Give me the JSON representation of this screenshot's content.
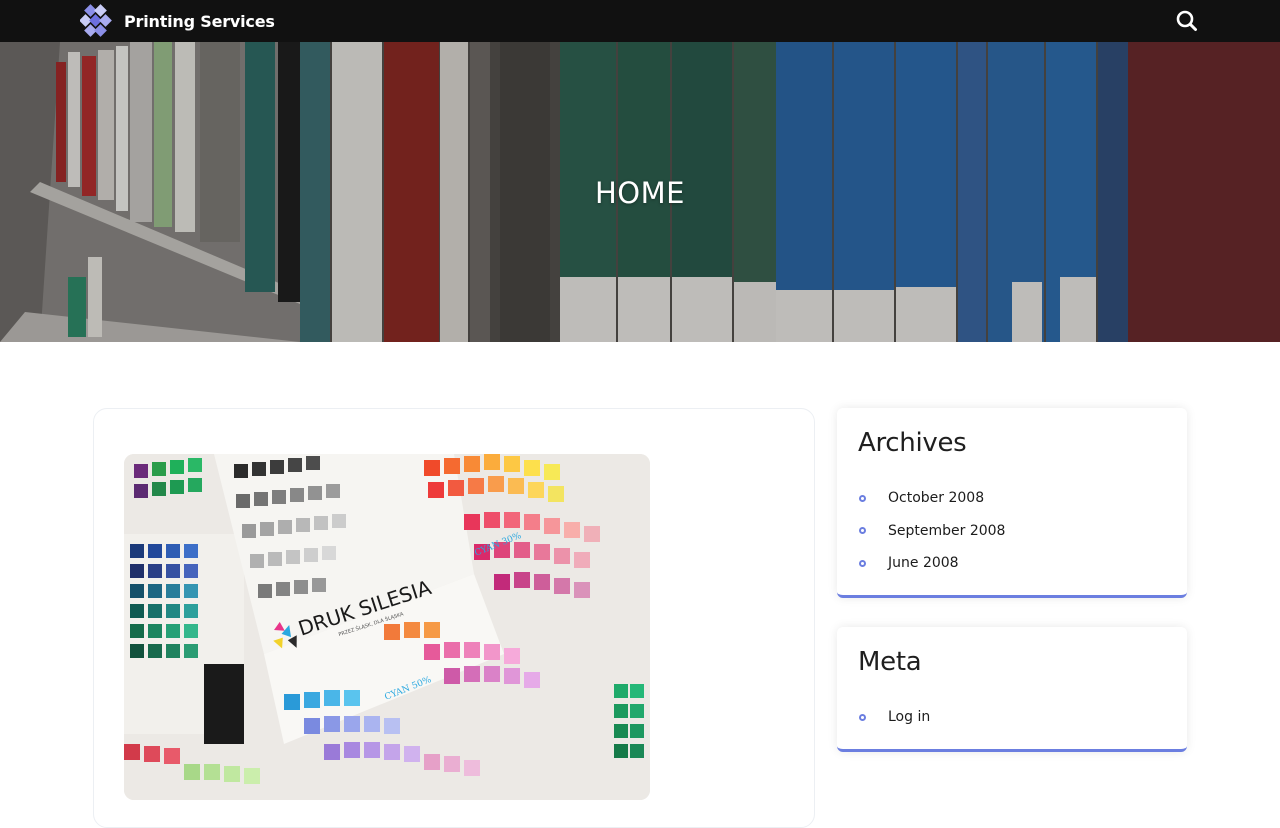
{
  "header": {
    "site_name": "Printing Services",
    "logo_icon": "checker-logo-icon",
    "search_icon": "search-icon"
  },
  "hero": {
    "title": "HOME"
  },
  "post": {
    "thumbnail_brand": "DRUK SILESIA",
    "thumbnail_tagline": "PRZEZ ŚLĄSK, DLA ŚLĄSKA",
    "thumbnail_labels": [
      "CYAN 30%",
      "CYAN 50%"
    ]
  },
  "sidebar": {
    "archives": {
      "title": "Archives",
      "items": [
        {
          "label": "October 2008"
        },
        {
          "label": "September 2008"
        },
        {
          "label": "June 2008"
        }
      ]
    },
    "meta": {
      "title": "Meta",
      "items": [
        {
          "label": "Log in"
        }
      ]
    }
  },
  "colors": {
    "topbar": "#111111",
    "accent": "#6b7ee0",
    "text": "#1c1c1c"
  }
}
